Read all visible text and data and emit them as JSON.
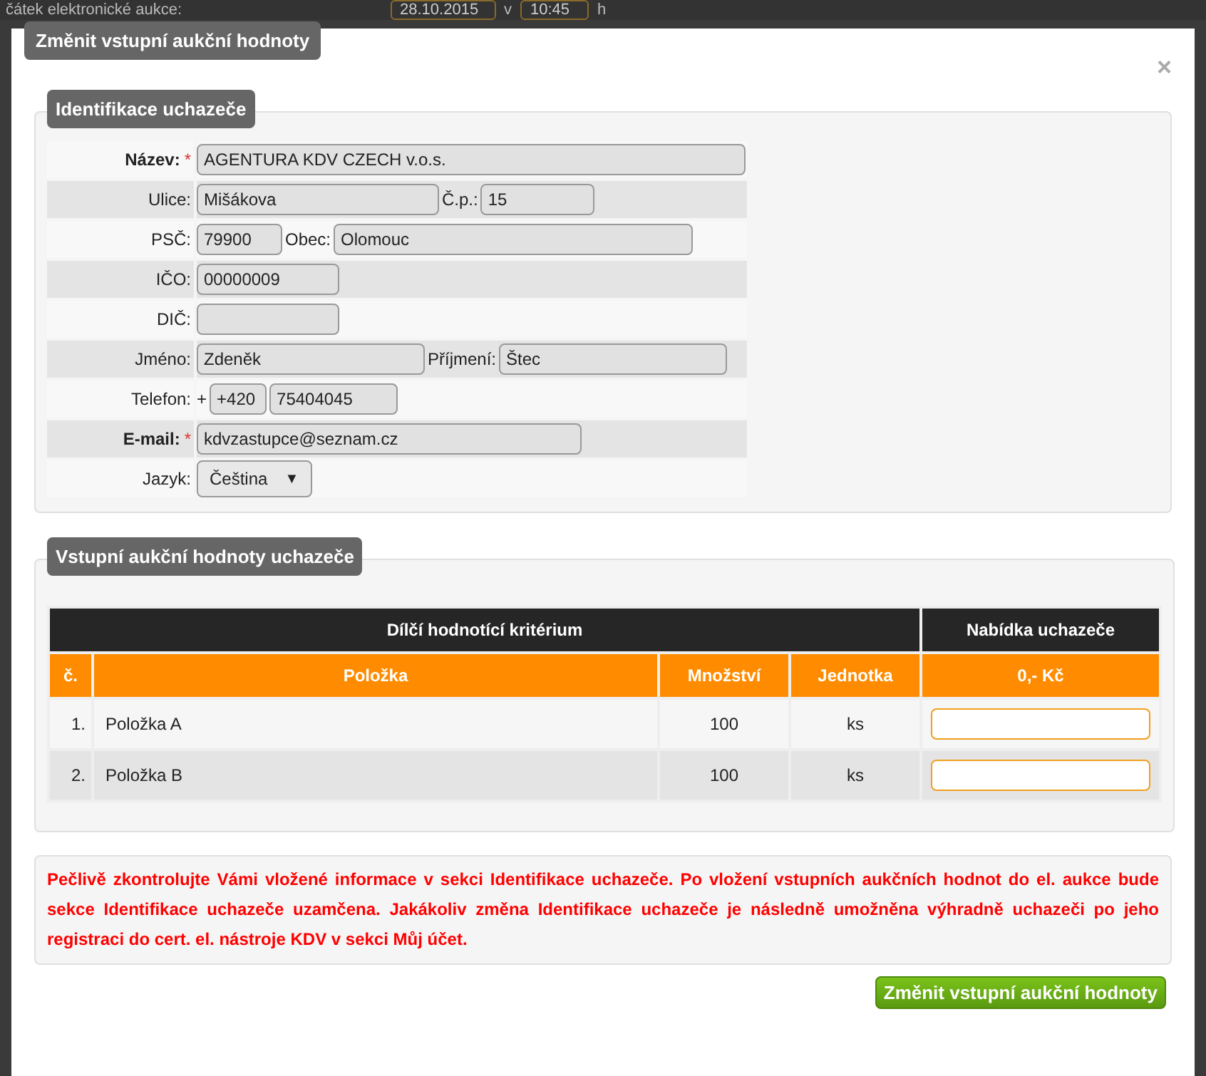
{
  "background": {
    "label": "čátek elektronické aukce:",
    "date": "28.10.2015",
    "at": "v",
    "time": "10:45",
    "unit": "h"
  },
  "dialog": {
    "title": "Změnit vstupní aukční hodnoty",
    "close": "×"
  },
  "identification": {
    "legend": "Identifikace uchazeče",
    "rows": [
      {
        "label": "Název:",
        "required": true,
        "mark": "*",
        "parts": [
          {
            "kind": "input",
            "value": "AGENTURA KDV CZECH v.o.s."
          }
        ]
      },
      {
        "label": "Ulice:",
        "required": false,
        "parts": [
          {
            "kind": "input",
            "value": "Mišákova"
          },
          {
            "kind": "label",
            "text": "Č.p.:"
          },
          {
            "kind": "input",
            "value": "15"
          }
        ]
      },
      {
        "label": "PSČ:",
        "required": false,
        "parts": [
          {
            "kind": "input",
            "value": "79900"
          },
          {
            "kind": "label",
            "text": "Obec:"
          },
          {
            "kind": "input",
            "value": "Olomouc"
          }
        ]
      },
      {
        "label": "IČO:",
        "required": false,
        "parts": [
          {
            "kind": "input",
            "value": "00000009"
          }
        ]
      },
      {
        "label": "DIČ:",
        "required": false,
        "parts": [
          {
            "kind": "input"
          }
        ]
      },
      {
        "label": "Jméno:",
        "required": false,
        "parts": [
          {
            "kind": "input",
            "value": "Zdeněk"
          },
          {
            "kind": "label",
            "text": "Příjmení:"
          },
          {
            "kind": "input",
            "value": "Štec"
          }
        ]
      },
      {
        "label": "Telefon:",
        "required": false,
        "parts": [
          {
            "kind": "label",
            "text": "+"
          },
          {
            "kind": "input",
            "value": "+420"
          },
          {
            "kind": "input",
            "value": "75404045"
          }
        ]
      },
      {
        "label": "E-mail:",
        "required": true,
        "mark": "*",
        "parts": [
          {
            "kind": "input",
            "value": "kdvzastupce@seznam.cz"
          }
        ]
      },
      {
        "label": "Jazyk:",
        "required": false,
        "parts": [
          {
            "kind": "select",
            "value": "Čeština",
            "caret": "▼"
          }
        ]
      }
    ]
  },
  "values": {
    "legend": "Vstupní aukční hodnoty uchazeče",
    "table": {
      "group_headers": [
        "Dílčí hodnotící kritérium",
        "Nabídka uchazeče"
      ],
      "columns": [
        "č.",
        "Položka",
        "Množství",
        "Jednotka",
        "0,- Kč"
      ],
      "rows": [
        {
          "number": "1.",
          "item": "Položka A",
          "quantity": "100",
          "unit": "ks"
        },
        {
          "number": "2.",
          "item": "Položka B",
          "quantity": "100",
          "unit": "ks"
        }
      ]
    }
  },
  "notice": "Pečlivě zkontrolujte Vámi vložené informace v sekci Identifikace uchazeče. Po vložení vstupních aukčních hodnot do el. aukce bude sekce Identifikace uchazeče uzamčena. Jakákoliv změna Identifikace uchazeče je následně umožněna výhradně uchazeči po jeho registraci do cert. el. nástroje KDV v sekci Můj účet.",
  "submit": "Změnit vstupní aukční hodnoty"
}
